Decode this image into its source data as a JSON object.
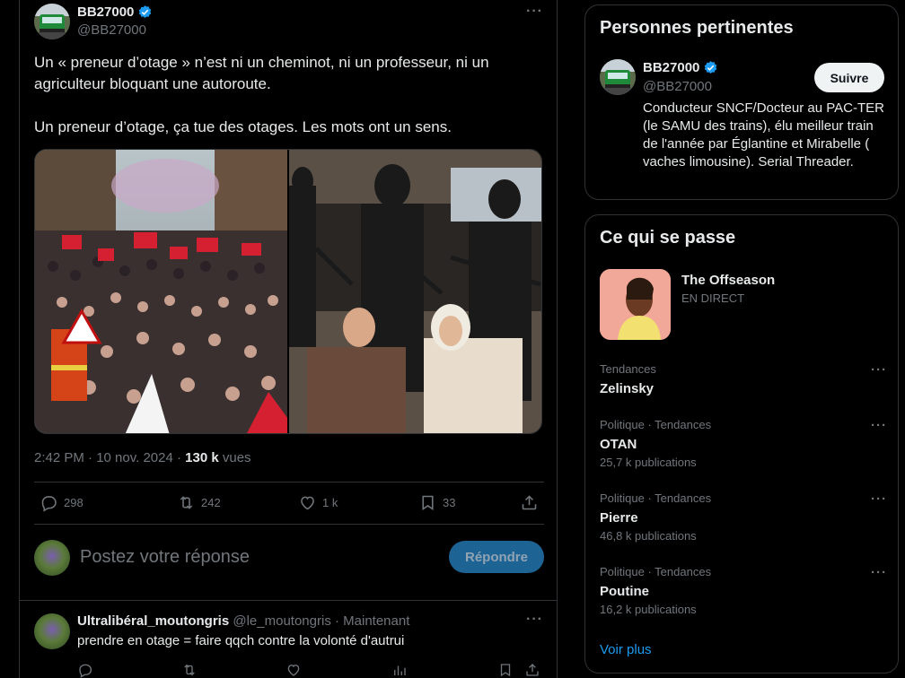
{
  "tweet": {
    "author_name": "BB27000",
    "author_handle": "@BB27000",
    "more_icon": "more-horizontal-icon",
    "text_p1": "Un « preneur d’otage » n’est ni un cheminot, ni un professeur, ni un agriculteur bloquant une autoroute.",
    "text_p2": "Un preneur d’otage, ça tue des otages. Les mots ont un sens.",
    "timestamp": "2:42 PM · 10 nov. 2024 · ",
    "views_count": "130 k",
    "views_label": " vues",
    "replies": "298",
    "reposts": "242",
    "likes": "1 k",
    "bookmarks": "33"
  },
  "reply_composer": {
    "placeholder": "Postez votre réponse",
    "button_label": "Répondre"
  },
  "reply": {
    "author_name": "Ultralibéral_moutongris",
    "author_handle": "@le_moutongris",
    "time": " · Maintenant",
    "text": "prendre en otage = faire qqch contre la volonté d'autrui"
  },
  "relevant_people": {
    "title": "Personnes pertinentes",
    "name": "BB27000",
    "handle": "@BB27000",
    "follow_label": "Suivre",
    "bio": "Conducteur SNCF/Docteur au PAC-TER (le SAMU des trains), élu meilleur train de l'année par Églantine et Mirabelle ( vaches limousine). Serial Threader."
  },
  "whats_happening": {
    "title": "Ce qui se passe",
    "live_title": "The Offseason",
    "live_subtitle": "EN DIRECT",
    "trends": [
      {
        "category": "Tendances",
        "name": "Zelinsky",
        "count": ""
      },
      {
        "category": "Politique · Tendances",
        "name": "OTAN",
        "count": "25,7 k publications"
      },
      {
        "category": "Politique · Tendances",
        "name": "Pierre",
        "count": "46,8 k publications"
      },
      {
        "category": "Politique · Tendances",
        "name": "Poutine",
        "count": "16,2 k publications"
      }
    ],
    "show_more": "Voir plus"
  },
  "colors": {
    "background": "#000000",
    "text": "#e7e9ea",
    "muted": "#71767b",
    "border": "#2f3336",
    "accent": "#1d9bf0"
  }
}
